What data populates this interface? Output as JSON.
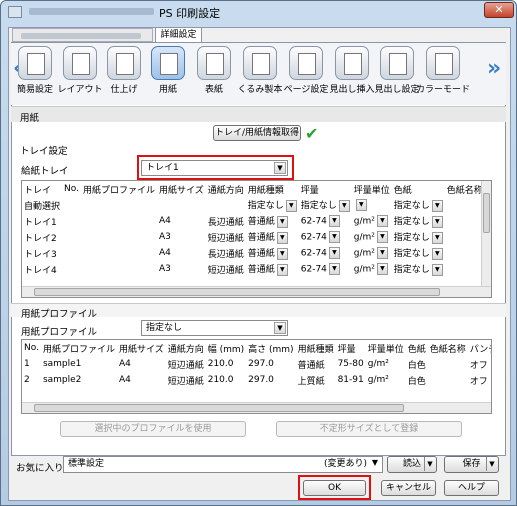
{
  "window": {
    "title": "PS 印刷設定",
    "close": "✕"
  },
  "tabs": {
    "active": "詳細設定"
  },
  "nav_buttons": [
    {
      "label": "簡易設定",
      "icon": "quick-setting-icon"
    },
    {
      "label": "レイアウト",
      "icon": "layout-icon"
    },
    {
      "label": "仕上げ",
      "icon": "finishing-icon"
    },
    {
      "label": "用紙",
      "icon": "paper-icon"
    },
    {
      "label": "表紙",
      "icon": "cover-icon"
    },
    {
      "label": "くるみ製本",
      "icon": "binding-icon"
    },
    {
      "label": "ページ設定",
      "icon": "page-setting-icon"
    },
    {
      "label": "見出し挿入",
      "icon": "tab-insert-icon"
    },
    {
      "label": "見出し設定",
      "icon": "tab-setting-icon"
    },
    {
      "label": "カラーモード",
      "icon": "color-mode-icon"
    }
  ],
  "section": {
    "title": "用紙"
  },
  "tray_settings": {
    "group_label": "トレイ設定",
    "get_info_button": "トレイ/用紙情報取得",
    "feed_tray_label": "給紙トレイ",
    "feed_tray_value": "トレイ1",
    "columns": [
      "トレイ",
      "No.",
      "用紙プロファイル",
      "用紙サイズ",
      "通紙方向",
      "用紙種類",
      "坪量",
      "坪量単位",
      "色紙",
      "色紙名称",
      "パ"
    ],
    "rows": [
      {
        "tray": "自動選択",
        "no": "",
        "profile": "",
        "size": "",
        "dir": "",
        "type": "指定なし",
        "basis": "指定なし",
        "unit": "",
        "color": "指定なし"
      },
      {
        "tray": "トレイ1",
        "no": "",
        "profile": "",
        "size": "A4",
        "dir": "長辺通紙",
        "type": "普通紙",
        "basis": "62-74",
        "unit": "g/m²",
        "color": "指定なし"
      },
      {
        "tray": "トレイ2",
        "no": "",
        "profile": "",
        "size": "A3",
        "dir": "短辺通紙",
        "type": "普通紙",
        "basis": "62-74",
        "unit": "g/m²",
        "color": "指定なし"
      },
      {
        "tray": "トレイ3",
        "no": "",
        "profile": "",
        "size": "A4",
        "dir": "長辺通紙",
        "type": "普通紙",
        "basis": "62-74",
        "unit": "g/m²",
        "color": "指定なし"
      },
      {
        "tray": "トレイ4",
        "no": "",
        "profile": "",
        "size": "A3",
        "dir": "短辺通紙",
        "type": "普通紙",
        "basis": "62-74",
        "unit": "g/m²",
        "color": "指定なし"
      }
    ]
  },
  "profile_settings": {
    "group_label": "用紙プロファイル",
    "profile_label": "用紙プロファイル",
    "profile_value": "指定なし",
    "columns": [
      "No.",
      "用紙プロファイル",
      "用紙サイズ",
      "通紙方向",
      "幅 (mm)",
      "高さ (mm)",
      "用紙種類",
      "坪量",
      "坪量単位",
      "色紙",
      "色紙名称",
      "パンチ穴ハ"
    ],
    "rows": [
      {
        "no": "1",
        "name": "sample1",
        "size": "A4",
        "dir": "短辺通紙",
        "w": "210.0",
        "h": "297.0",
        "type": "普通紙",
        "basis": "75-80",
        "unit": "g/m²",
        "color": "白色",
        "cname": "",
        "punch": "オフ"
      },
      {
        "no": "2",
        "name": "sample2",
        "size": "A4",
        "dir": "短辺通紙",
        "w": "210.0",
        "h": "297.0",
        "type": "上質紙",
        "basis": "81-91",
        "unit": "g/m²",
        "color": "白色",
        "cname": "",
        "punch": "オフ"
      }
    ],
    "use_selected_button": "選択中のプロファイルを使用",
    "register_button": "不定形サイズとして登録"
  },
  "favorites": {
    "label": "お気に入り",
    "value": "標準設定",
    "changed": "(変更あり)",
    "load": "読込",
    "save": "保存"
  },
  "footer": {
    "ok": "OK",
    "cancel": "キャンセル",
    "help": "ヘルプ"
  }
}
